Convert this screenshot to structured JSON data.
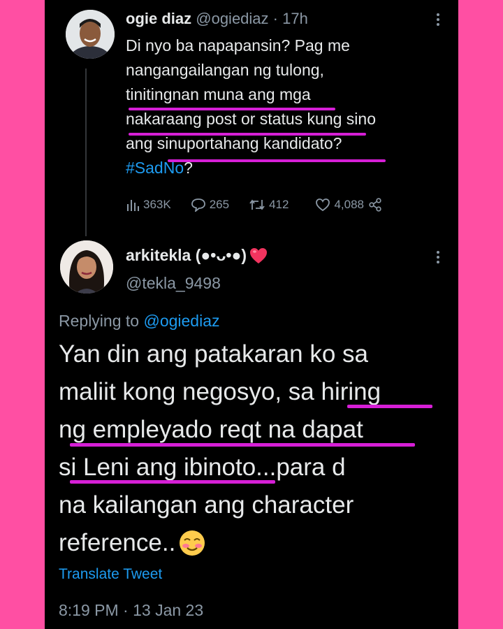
{
  "tweet1": {
    "display_name": "ogie diaz",
    "handle": "@ogiediaz",
    "time": "· 17h",
    "lines": [
      "Di nyo ba napapansin? Pag me",
      "nangangailangan ng tulong,",
      "tinitingnan muna ang mga",
      "nakaraang post or status kung sino",
      "ang sinuportahang kandidato?"
    ],
    "hashtag": "#SadNo",
    "hashtag_suffix": "?",
    "stats": {
      "views": "363K",
      "replies": "265",
      "retweets": "412",
      "likes": "4,088"
    }
  },
  "tweet2": {
    "display_name": "arkitekla (●•ᴗ•●)",
    "handle": "@tekla_9498",
    "replying_prefix": "Replying to",
    "replying_handle": "@ogiediaz",
    "lines": [
      "Yan din ang patakaran ko sa",
      "maliit kong negosyo, sa hiring",
      "ng empleyado reqt na dapat",
      "si Leni ang ibinoto...para d",
      "na kailangan ang character",
      "reference.."
    ],
    "translate": "Translate Tweet",
    "timestamp": "8:19 PM · 13 Jan 23"
  },
  "colors": {
    "background": "#ff4fa3",
    "card": "#000000",
    "highlight": "#d61fd6",
    "link": "#1d9bf0",
    "muted": "#8b98a5"
  },
  "icons": [
    "views-icon",
    "reply-icon",
    "retweet-icon",
    "like-icon",
    "share-icon",
    "more-icon",
    "heart-emoji-icon",
    "blush-emoji-icon"
  ]
}
